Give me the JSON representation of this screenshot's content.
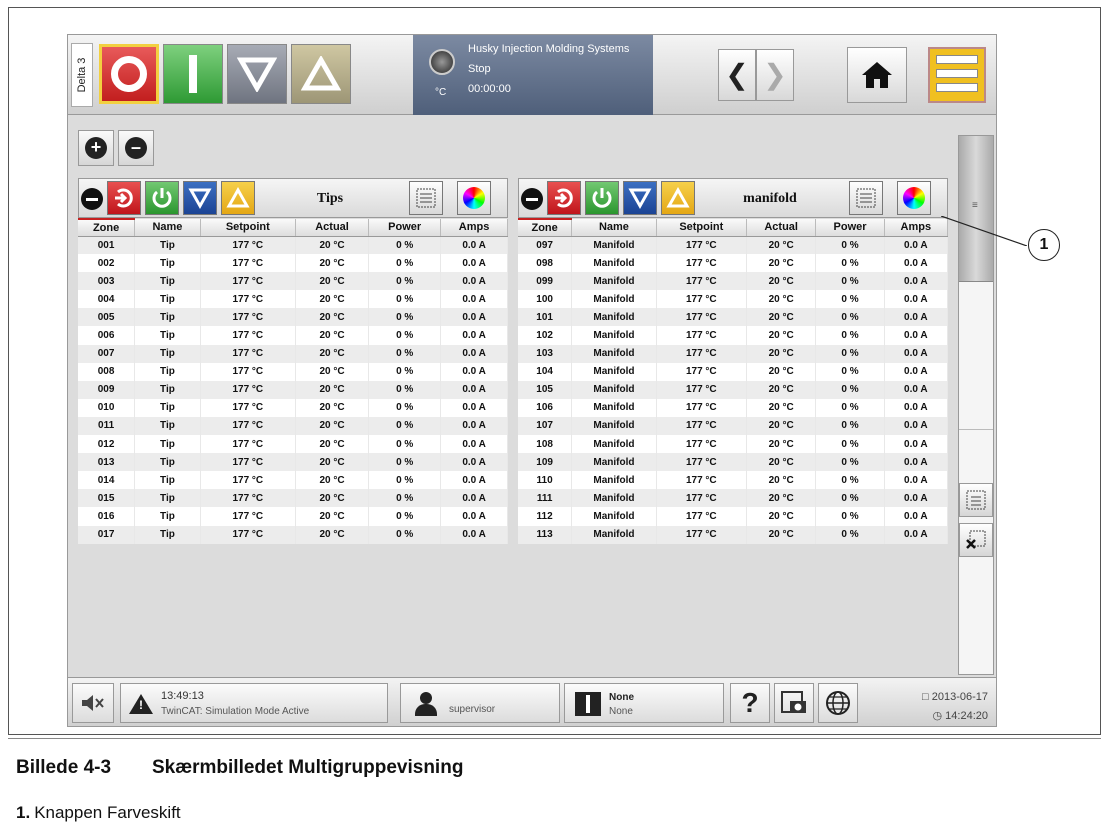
{
  "topbar": {
    "machine_tab": "Delta 3",
    "status_line1": "Husky Injection Molding Systems",
    "status_line2": "Stop",
    "status_line3": "00:00:00",
    "temp_unit": "°C"
  },
  "panels": [
    {
      "label": "Tips",
      "columns": [
        "Zone",
        "Name",
        "Setpoint",
        "Actual",
        "Power",
        "Amps"
      ],
      "rows": [
        [
          "001",
          "Tip",
          "177 °C",
          "20 °C",
          "0 %",
          "0.0 A"
        ],
        [
          "002",
          "Tip",
          "177 °C",
          "20 °C",
          "0 %",
          "0.0 A"
        ],
        [
          "003",
          "Tip",
          "177 °C",
          "20 °C",
          "0 %",
          "0.0 A"
        ],
        [
          "004",
          "Tip",
          "177 °C",
          "20 °C",
          "0 %",
          "0.0 A"
        ],
        [
          "005",
          "Tip",
          "177 °C",
          "20 °C",
          "0 %",
          "0.0 A"
        ],
        [
          "006",
          "Tip",
          "177 °C",
          "20 °C",
          "0 %",
          "0.0 A"
        ],
        [
          "007",
          "Tip",
          "177 °C",
          "20 °C",
          "0 %",
          "0.0 A"
        ],
        [
          "008",
          "Tip",
          "177 °C",
          "20 °C",
          "0 %",
          "0.0 A"
        ],
        [
          "009",
          "Tip",
          "177 °C",
          "20 °C",
          "0 %",
          "0.0 A"
        ],
        [
          "010",
          "Tip",
          "177 °C",
          "20 °C",
          "0 %",
          "0.0 A"
        ],
        [
          "011",
          "Tip",
          "177 °C",
          "20 °C",
          "0 %",
          "0.0 A"
        ],
        [
          "012",
          "Tip",
          "177 °C",
          "20 °C",
          "0 %",
          "0.0 A"
        ],
        [
          "013",
          "Tip",
          "177 °C",
          "20 °C",
          "0 %",
          "0.0 A"
        ],
        [
          "014",
          "Tip",
          "177 °C",
          "20 °C",
          "0 %",
          "0.0 A"
        ],
        [
          "015",
          "Tip",
          "177 °C",
          "20 °C",
          "0 %",
          "0.0 A"
        ],
        [
          "016",
          "Tip",
          "177 °C",
          "20 °C",
          "0 %",
          "0.0 A"
        ],
        [
          "017",
          "Tip",
          "177 °C",
          "20 °C",
          "0 %",
          "0.0 A"
        ]
      ]
    },
    {
      "label": "manifold",
      "columns": [
        "Zone",
        "Name",
        "Setpoint",
        "Actual",
        "Power",
        "Amps"
      ],
      "rows": [
        [
          "097",
          "Manifold",
          "177 °C",
          "20 °C",
          "0 %",
          "0.0 A"
        ],
        [
          "098",
          "Manifold",
          "177 °C",
          "20 °C",
          "0 %",
          "0.0 A"
        ],
        [
          "099",
          "Manifold",
          "177 °C",
          "20 °C",
          "0 %",
          "0.0 A"
        ],
        [
          "100",
          "Manifold",
          "177 °C",
          "20 °C",
          "0 %",
          "0.0 A"
        ],
        [
          "101",
          "Manifold",
          "177 °C",
          "20 °C",
          "0 %",
          "0.0 A"
        ],
        [
          "102",
          "Manifold",
          "177 °C",
          "20 °C",
          "0 %",
          "0.0 A"
        ],
        [
          "103",
          "Manifold",
          "177 °C",
          "20 °C",
          "0 %",
          "0.0 A"
        ],
        [
          "104",
          "Manifold",
          "177 °C",
          "20 °C",
          "0 %",
          "0.0 A"
        ],
        [
          "105",
          "Manifold",
          "177 °C",
          "20 °C",
          "0 %",
          "0.0 A"
        ],
        [
          "106",
          "Manifold",
          "177 °C",
          "20 °C",
          "0 %",
          "0.0 A"
        ],
        [
          "107",
          "Manifold",
          "177 °C",
          "20 °C",
          "0 %",
          "0.0 A"
        ],
        [
          "108",
          "Manifold",
          "177 °C",
          "20 °C",
          "0 %",
          "0.0 A"
        ],
        [
          "109",
          "Manifold",
          "177 °C",
          "20 °C",
          "0 %",
          "0.0 A"
        ],
        [
          "110",
          "Manifold",
          "177 °C",
          "20 °C",
          "0 %",
          "0.0 A"
        ],
        [
          "111",
          "Manifold",
          "177 °C",
          "20 °C",
          "0 %",
          "0.0 A"
        ],
        [
          "112",
          "Manifold",
          "177 °C",
          "20 °C",
          "0 %",
          "0.0 A"
        ],
        [
          "113",
          "Manifold",
          "177 °C",
          "20 °C",
          "0 %",
          "0.0 A"
        ]
      ]
    }
  ],
  "bottombar": {
    "alarm_time": "13:49:13",
    "alarm_message": "TwinCAT: Simulation Mode Active",
    "user": "supervisor",
    "mold_title": "None",
    "mold_sub": "None",
    "help": "?",
    "date": "2013-06-17",
    "time": "14:24:20"
  },
  "callout": "1",
  "caption": {
    "number": "Billede 4-3",
    "title": "Skærmbilledet Multigruppevisning",
    "legend_num": "1.",
    "legend_text": "Knappen Farveskift"
  },
  "icons": [
    "stop-ring-icon",
    "on-bar-icon",
    "down-triangle-icon",
    "up-triangle-icon",
    "back-arrow-icon",
    "forward-arrow-icon",
    "home-icon",
    "plus-icon",
    "minus-icon",
    "grid-icon",
    "color-wheel-icon",
    "mute-icon",
    "warning-icon",
    "user-icon",
    "mold-icon",
    "camera-icon",
    "globe-icon"
  ]
}
